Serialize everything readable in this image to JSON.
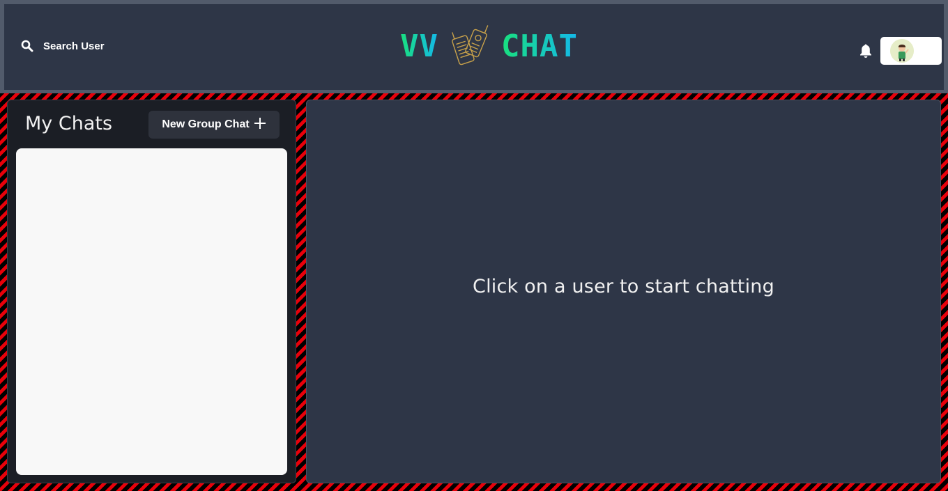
{
  "header": {
    "search_label": "Search User",
    "logo_left": "VV",
    "logo_right": "CHAT"
  },
  "icons": {
    "search": "search-icon",
    "logo": "walkie-talkie-icon",
    "notifications": "bell-icon",
    "profile": "avatar"
  },
  "sidebar": {
    "title": "My Chats",
    "new_group_label": "New Group Chat"
  },
  "chat_box": {
    "empty_message": "Click on a user to start chatting"
  },
  "colors": {
    "header_bg": "#2e3647",
    "panel_bg": "#1b1e25",
    "chat_bg": "#2e3647",
    "logo_gradient_start": "#19e07e",
    "logo_gradient_end": "#14b8ea",
    "background_accent": "#e8000a"
  }
}
